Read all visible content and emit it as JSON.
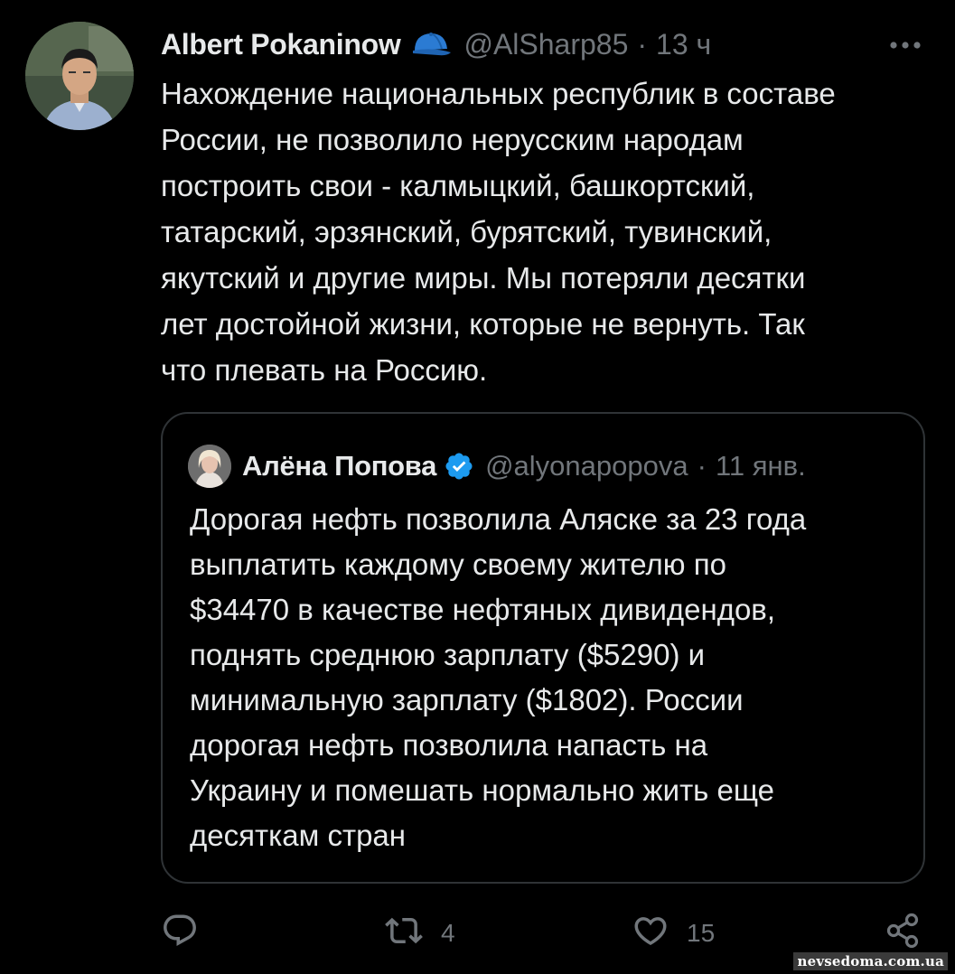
{
  "tweet": {
    "author_name": "Albert Pokaninow",
    "author_badge_icon": "cap-icon",
    "handle": "@AlSharp85",
    "separator": "·",
    "time": "13 ч",
    "more_icon": "more-icon",
    "text": "Нахождение национальных республик в составе\nРоссии, не позволило нерусским народам\nпостроить свои - калмыцкий, башкортский,\nтатарский, эрзянский, бурятский, тувинский,\nякутский и другие миры. Мы потеряли десятки\nлет достойной жизни, которые не вернуть. Так\nчто плевать на Россию."
  },
  "quoted_tweet": {
    "author_name": "Алёна Попова",
    "verified_icon": "verified-icon",
    "handle": "@alyonapopova",
    "separator": "·",
    "time": "11 янв.",
    "text": "Дорогая нефть позволила Аляске за 23 года\nвыплатить каждому своему жителю по\n$34470 в качестве нефтяных дивидендов,\nподнять среднюю зарплату ($5290) и\nминимальную зарплату ($1802). России\nдорогая нефть позволила напасть на\nУкраину и помешать нормально жить еще\nдесяткам стран"
  },
  "actions": {
    "reply": {
      "icon": "reply-icon",
      "count": ""
    },
    "retweet": {
      "icon": "retweet-icon",
      "count": "4"
    },
    "like": {
      "icon": "heart-icon",
      "count": "15"
    },
    "share": {
      "icon": "share-icon"
    }
  },
  "watermark": "nevsedoma.com.ua",
  "colors": {
    "background": "#000000",
    "text": "#e7e9ea",
    "secondary": "#71767b",
    "border": "#2f3336",
    "verified": "#1d9bf0",
    "badge": "#2b7bd3"
  }
}
